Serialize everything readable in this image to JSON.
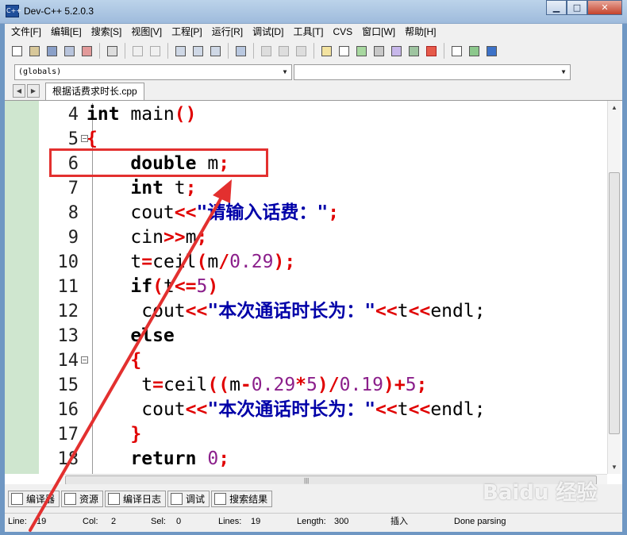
{
  "window": {
    "title": "Dev-C++ 5.2.0.3",
    "icon": "devcpp-app-icon"
  },
  "window_buttons": {
    "minimize": "▁",
    "maximize": "□",
    "close": "✕"
  },
  "menu": [
    {
      "label": "文件[F]"
    },
    {
      "label": "编辑[E]"
    },
    {
      "label": "搜索[S]"
    },
    {
      "label": "视图[V]"
    },
    {
      "label": "工程[P]"
    },
    {
      "label": "运行[R]"
    },
    {
      "label": "调试[D]"
    },
    {
      "label": "工具[T]"
    },
    {
      "label": "CVS"
    },
    {
      "label": "窗口[W]"
    },
    {
      "label": "帮助[H]"
    }
  ],
  "combos": {
    "scope": "(globals)",
    "symbol": ""
  },
  "tab": {
    "label": "根据话费求时长.cpp"
  },
  "code_lines": [
    {
      "no": "4",
      "fold": ""
    },
    {
      "no": "5",
      "fold": "⊟"
    },
    {
      "no": "6",
      "fold": ""
    },
    {
      "no": "7",
      "fold": ""
    },
    {
      "no": "8",
      "fold": ""
    },
    {
      "no": "9",
      "fold": ""
    },
    {
      "no": "10",
      "fold": ""
    },
    {
      "no": "11",
      "fold": ""
    },
    {
      "no": "12",
      "fold": ""
    },
    {
      "no": "13",
      "fold": ""
    },
    {
      "no": "14",
      "fold": "⊟"
    },
    {
      "no": "15",
      "fold": ""
    },
    {
      "no": "16",
      "fold": ""
    },
    {
      "no": "17",
      "fold": ""
    },
    {
      "no": "18",
      "fold": ""
    }
  ],
  "code": {
    "l4": [
      "int",
      " main",
      "()"
    ],
    "l5": [
      "{"
    ],
    "l6": [
      "    ",
      "double",
      " m",
      ";"
    ],
    "l7": [
      "    ",
      "int",
      " t",
      ";"
    ],
    "l8": [
      "    ",
      "cout",
      "<<",
      "\"请输入话费：\"",
      ";"
    ],
    "l9": [
      "    ",
      "cin",
      ">>",
      "m",
      ";"
    ],
    "l10": [
      "    ",
      "t",
      "=",
      "ceil",
      "(",
      "m",
      "/",
      "0.29",
      ");"
    ],
    "l11": [
      "    ",
      "if",
      "(",
      "t",
      "<=",
      "5",
      ")"
    ],
    "l12": [
      "     ",
      "cout",
      "<<",
      "\"本次通话时长为：\"",
      "<<",
      "t",
      "<<",
      "endl;"
    ],
    "l13": [
      "    ",
      "else"
    ],
    "l14": [
      "    ",
      "{"
    ],
    "l15": [
      "     ",
      "t",
      "=",
      "ceil",
      "((",
      "m",
      "-",
      "0.29",
      "*",
      "5",
      ")/",
      "0.19",
      ")+",
      "5",
      ";"
    ],
    "l16": [
      "     ",
      "cout",
      "<<",
      "\"本次通话时长为：\"",
      "<<",
      "t",
      "<<",
      "endl;"
    ],
    "l17": [
      "    ",
      "}"
    ],
    "l18": [
      "    ",
      "return",
      " 0",
      ";"
    ]
  },
  "bottom_tabs": [
    {
      "label": "编译器",
      "icon": "compiler-icon"
    },
    {
      "label": "资源",
      "icon": "resources-icon"
    },
    {
      "label": "编译日志",
      "icon": "compile-log-icon"
    },
    {
      "label": "调试",
      "icon": "debug-icon"
    },
    {
      "label": "搜索结果",
      "icon": "search-results-icon"
    }
  ],
  "status": {
    "line_label": "Line:",
    "line_value": "19",
    "col_label": "Col:",
    "col_value": "2",
    "sel_label": "Sel:",
    "sel_value": "0",
    "lines_label": "Lines:",
    "lines_value": "19",
    "length_label": "Length:",
    "length_value": "300",
    "mode": "插入",
    "state": "Done parsing"
  },
  "watermark": "Baidu 经验",
  "annotation_colors": {
    "box": "#e3302f",
    "arrow": "#e3302f"
  }
}
